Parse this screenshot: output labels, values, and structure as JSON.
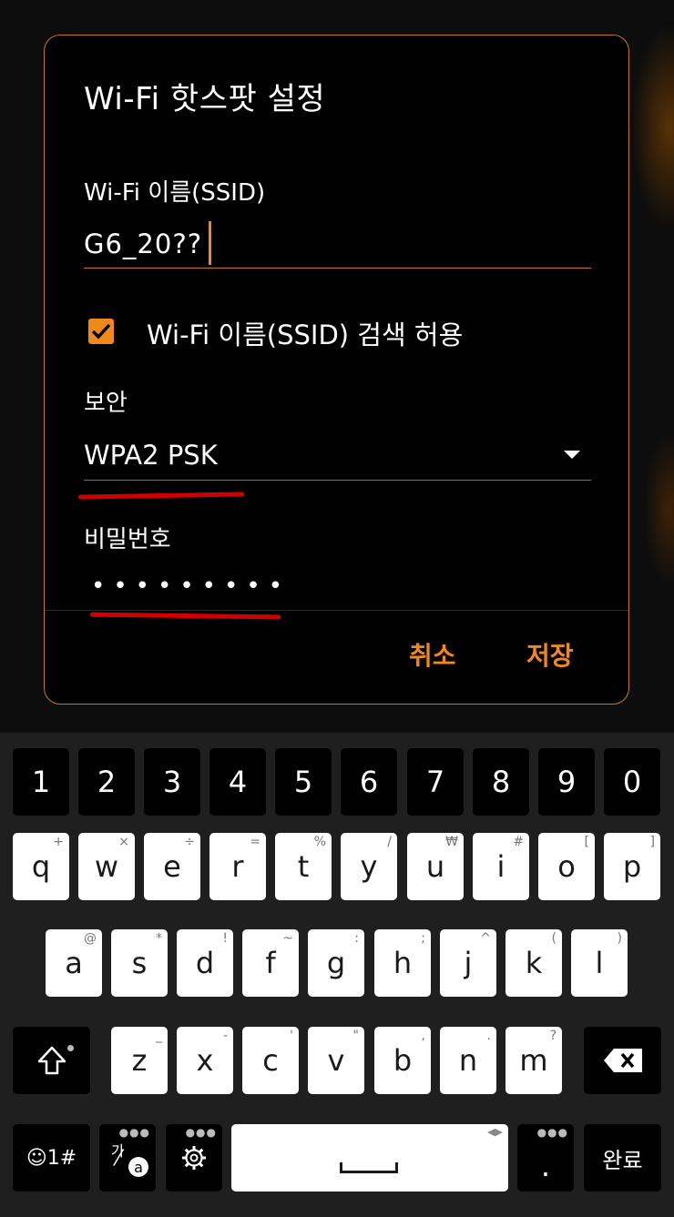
{
  "dialog": {
    "title": "Wi-Fi 핫스팟 설정",
    "ssid_label": "Wi-Fi 이름(SSID)",
    "ssid_value": "G6_20??",
    "broadcast_checkbox_label": "Wi-Fi 이름(SSID) 검색 허용",
    "broadcast_checked": true,
    "security_label": "보안",
    "security_value": "WPA2 PSK",
    "password_label": "비밀번호",
    "password_masked": "•••••••••",
    "cancel_label": "취소",
    "save_label": "저장"
  },
  "keyboard": {
    "numbers": [
      "1",
      "2",
      "3",
      "4",
      "5",
      "6",
      "7",
      "8",
      "9",
      "0"
    ],
    "row1": [
      {
        "key": "q",
        "hint": "+"
      },
      {
        "key": "w",
        "hint": "×"
      },
      {
        "key": "e",
        "hint": "÷"
      },
      {
        "key": "r",
        "hint": "="
      },
      {
        "key": "t",
        "hint": "%"
      },
      {
        "key": "y",
        "hint": "/"
      },
      {
        "key": "u",
        "hint": "₩"
      },
      {
        "key": "i",
        "hint": "#"
      },
      {
        "key": "o",
        "hint": "["
      },
      {
        "key": "p",
        "hint": "]"
      }
    ],
    "row2": [
      {
        "key": "a",
        "hint": "@"
      },
      {
        "key": "s",
        "hint": "*"
      },
      {
        "key": "d",
        "hint": "!"
      },
      {
        "key": "f",
        "hint": "~"
      },
      {
        "key": "g",
        "hint": ":"
      },
      {
        "key": "h",
        "hint": ";"
      },
      {
        "key": "j",
        "hint": "^"
      },
      {
        "key": "k",
        "hint": "("
      },
      {
        "key": "l",
        "hint": ")"
      }
    ],
    "row3": [
      {
        "key": "z",
        "hint": "_"
      },
      {
        "key": "x",
        "hint": "-"
      },
      {
        "key": "c",
        "hint": "'"
      },
      {
        "key": "v",
        "hint": "\""
      },
      {
        "key": "b",
        "hint": ","
      },
      {
        "key": "n",
        "hint": "."
      },
      {
        "key": "m",
        "hint": "?"
      }
    ],
    "symbols_label": "☺1#",
    "lang_label": "가",
    "lang_sub": "a",
    "period_label": ".",
    "done_label": "완료"
  },
  "colors": {
    "accent": "#f0891c",
    "annotation": "#d00000",
    "dialog_bg": "#000000",
    "keyboard_bg": "#1f1f1f"
  }
}
